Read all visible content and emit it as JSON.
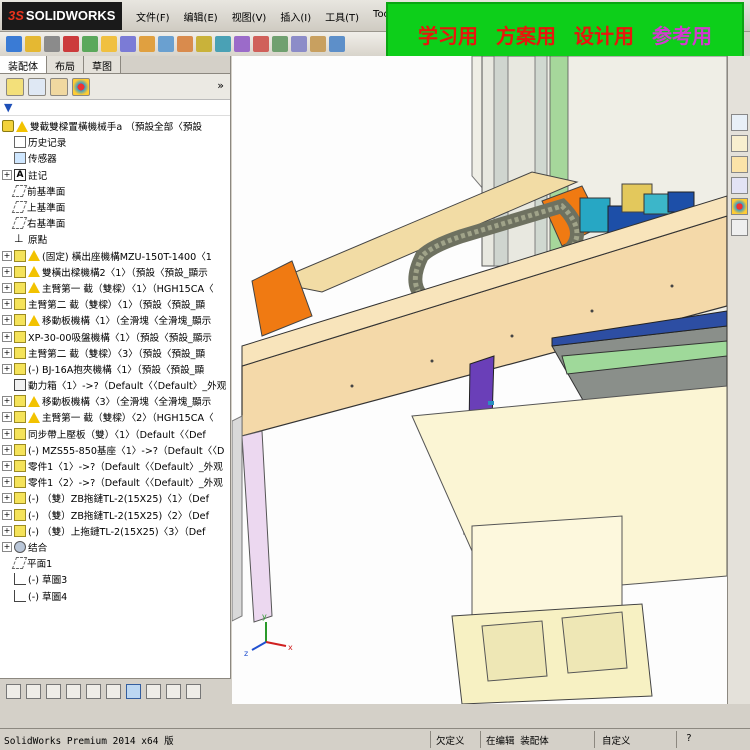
{
  "app": {
    "logo": "SOLIDWORKS",
    "logo_prefix": "3S"
  },
  "menu": {
    "items": [
      "文件(F)",
      "编辑(E)",
      "视图(V)",
      "插入(I)",
      "工具(T)",
      "Too"
    ]
  },
  "banner": {
    "items": [
      {
        "text": "学习用",
        "color": "#e8160c"
      },
      {
        "text": "方案用",
        "color": "#e8160c"
      },
      {
        "text": "设计用",
        "color": "#e8160c"
      },
      {
        "text": "参考用",
        "color": "#d33ad0"
      }
    ]
  },
  "panel": {
    "tabs": [
      "装配体",
      "布局",
      "草图"
    ],
    "active_tab": "装配体",
    "collapse": "»"
  },
  "tree": {
    "root": "雙截雙樑置橫機械手a （預設全部〈預設",
    "items": [
      {
        "icon": "hist",
        "label": "历史记录",
        "expand": ""
      },
      {
        "icon": "sensor",
        "label": "传感器",
        "expand": ""
      },
      {
        "icon": "note",
        "label": "註记",
        "expand": "+"
      },
      {
        "icon": "plane",
        "label": "前基準面",
        "expand": ""
      },
      {
        "icon": "plane",
        "label": "上基準面",
        "expand": ""
      },
      {
        "icon": "plane",
        "label": "右基準面",
        "expand": ""
      },
      {
        "icon": "origin",
        "label": "原點",
        "expand": ""
      },
      {
        "icon": "warn",
        "label": "(固定) 橫出座機構MZU-150T-1400〈1",
        "expand": "+"
      },
      {
        "icon": "warn",
        "label": "雙橫出樑機構2〈1〉（預設〈預設_顯示",
        "expand": "+"
      },
      {
        "icon": "warn",
        "label": "主臂第一 截（雙樑）〈1〉（HGH15CA〈",
        "expand": "+"
      },
      {
        "icon": "part",
        "label": "主臂第二 截（雙樑）〈1〉（預設〈預設_顯",
        "expand": "+"
      },
      {
        "icon": "warn",
        "label": "移動板機構〈1〉（全滑塊〈全滑塊_顯示",
        "expand": "+"
      },
      {
        "icon": "part",
        "label": "XP-30-00吸盤機構〈1〉（預設〈預設_顯示",
        "expand": "+"
      },
      {
        "icon": "part",
        "label": "主臂第二 截（雙樑）〈3〉（預設〈預設_顯",
        "expand": "+"
      },
      {
        "icon": "part",
        "label": "(-) BJ-16A抱夾機構〈1〉（預設〈預設_顯",
        "expand": "+"
      },
      {
        "icon": "dash",
        "label": "動力箱〈1〉->?（Default〈〈Default〉_外观",
        "expand": ""
      },
      {
        "icon": "warn",
        "label": "移動板機構〈3〉（全滑塊〈全滑塊_顯示",
        "expand": "+"
      },
      {
        "icon": "warn",
        "label": "主臂第一 截（雙樑）〈2〉（HGH15CA〈",
        "expand": "+"
      },
      {
        "icon": "part",
        "label": "同步帶上壓板（雙）〈1〉（Default〈〈Def",
        "expand": "+"
      },
      {
        "icon": "part",
        "label": "(-) MZS55-850基座〈1〉->?（Default〈〈D",
        "expand": "+"
      },
      {
        "icon": "part",
        "label": "零件1〈1〉->?（Default〈〈Default〉_外观",
        "expand": "+"
      },
      {
        "icon": "part",
        "label": "零件1〈2〉->?（Default〈〈Default〉_外观",
        "expand": "+"
      },
      {
        "icon": "part",
        "label": "(-) （雙）ZB拖鏈TL-2(15X25)〈1〉（Def",
        "expand": "+"
      },
      {
        "icon": "part",
        "label": "(-) （雙）ZB拖鏈TL-2(15X25)〈2〉（Def",
        "expand": "+"
      },
      {
        "icon": "part",
        "label": "(-) （雙）上拖鏈TL-2(15X25)〈3〉（Def",
        "expand": "+"
      },
      {
        "icon": "mate",
        "label": "结合",
        "expand": "+"
      },
      {
        "icon": "plane",
        "label": "平面1",
        "expand": ""
      },
      {
        "icon": "sketch",
        "label": "(-) 草圖3",
        "expand": ""
      },
      {
        "icon": "sketch",
        "label": "(-) 草圖4",
        "expand": ""
      }
    ]
  },
  "triad": {
    "x": "x",
    "y": "y",
    "z": "z"
  },
  "status": {
    "product": "SolidWorks Premium 2014 x64 版",
    "state": "欠定义",
    "editing": "在编辑 装配体",
    "units": "自定义",
    "help": "?"
  },
  "colors": {
    "beam": "#f3d9a8",
    "orange": "#f07a12",
    "cyan": "#27a7c4",
    "blue": "#1d4fa8",
    "purple": "#6a3fb8",
    "chain": "#7d8068",
    "banner_bg": "#0dcf1a"
  }
}
